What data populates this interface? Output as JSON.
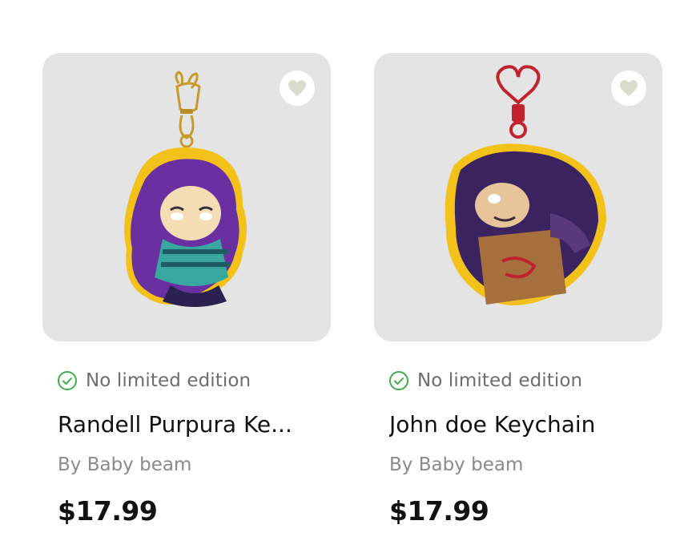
{
  "products": [
    {
      "edition": "No limited edition",
      "name": "Randell Purpura Ke...",
      "by": "By Baby beam",
      "price": "$17.99",
      "favorite_icon": "heart-icon",
      "edition_icon": "check-circle-icon"
    },
    {
      "edition": "No limited edition",
      "name": "John doe Keychain",
      "by": "By Baby beam",
      "price": "$17.99",
      "favorite_icon": "heart-icon",
      "edition_icon": "check-circle-icon"
    }
  ],
  "colors": {
    "card_bg": "#e4e4e4",
    "check_green": "#3fae49",
    "heart": "#d9dccd",
    "text_dark": "#111111",
    "text_muted": "#8a8a8a"
  }
}
